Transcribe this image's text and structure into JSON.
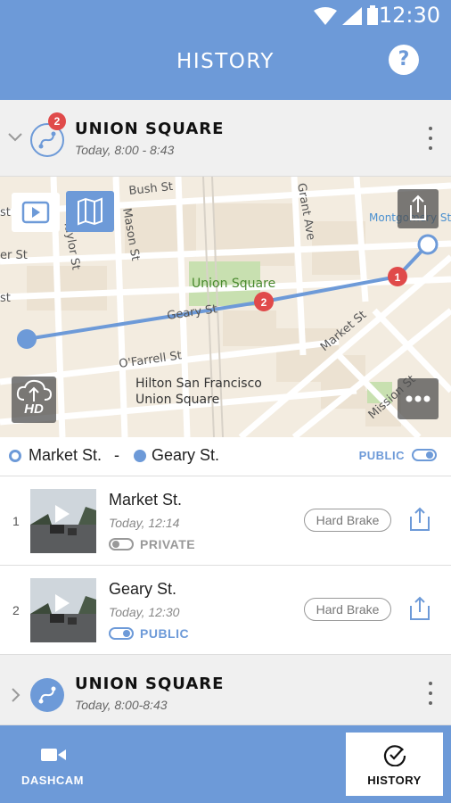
{
  "status_bar": {
    "time": "12:30"
  },
  "app_bar": {
    "title": "HISTORY",
    "help_label": "?"
  },
  "trip_1": {
    "badge": "2",
    "title": "UNION SQUARE",
    "subtitle": "Today, 8:00 - 8:43"
  },
  "map": {
    "streets": [
      "Bush St",
      "Grant Ave",
      "Mason St",
      "Taylor St",
      "Geary St",
      "O'Farrell St",
      "Market St",
      "Mission St",
      "Montgomery St",
      "st",
      "er St",
      "st"
    ],
    "places": [
      "Union Square",
      "Hilton San Francisco",
      "Union Square"
    ],
    "markers": [
      "1",
      "2"
    ],
    "hd_label": "HD"
  },
  "route": {
    "from": "Market St.",
    "separator": "-",
    "to": "Geary St.",
    "visibility": "PUBLIC"
  },
  "clips": [
    {
      "index": "1",
      "title": "Market St.",
      "time": "Today, 12:14",
      "privacy": "PRIVATE",
      "tag": "Hard Brake"
    },
    {
      "index": "2",
      "title": "Geary St.",
      "time": "Today, 12:30",
      "privacy": "PUBLIC",
      "tag": "Hard Brake"
    }
  ],
  "trip_2": {
    "title": "UNION SQUARE",
    "subtitle": "Today, 8:00-8:43"
  },
  "bottom_nav": {
    "dashcam_label": "DASHCAM",
    "history_label": "HISTORY"
  },
  "colors": {
    "primary": "#6d9ad8",
    "marker": "#e04a4a",
    "map_bg": "#f3ece0",
    "park": "#c8e0b0"
  },
  "icons": [
    "wifi-icon",
    "signal-icon",
    "battery-icon",
    "help-icon",
    "chevron-down-icon",
    "route-icon",
    "play-video-icon",
    "map-icon",
    "share-icon",
    "upload-cloud-icon",
    "more-icon",
    "chevron-right-icon",
    "video-camera-icon",
    "check-circle-icon"
  ]
}
